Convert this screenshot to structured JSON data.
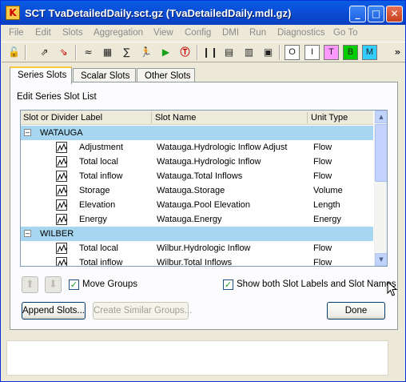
{
  "window": {
    "title": "SCT TvaDetailedDaily.sct.gz (TvaDetailedDaily.mdl.gz)",
    "app_icon_glyph": "K",
    "controls": {
      "minimize": "_",
      "maximize": "□",
      "close": "✕"
    }
  },
  "menu": [
    "File",
    "Edit",
    "Slots",
    "Aggregation",
    "View",
    "Config",
    "DMI",
    "Run",
    "Diagnostics",
    "Go To"
  ],
  "toolbar": {
    "icons": [
      "unlock-icon",
      "open-slot-icon",
      "close-slot-icon",
      "plot-icon",
      "graph-icon",
      "calculator-icon",
      "runner-icon",
      "play-icon",
      "stop-d-icon",
      "bar-icon",
      "expand-icon",
      "collapse-icon",
      "fit-icon"
    ],
    "letter_buttons": [
      {
        "label": "O",
        "color": "#ffffff"
      },
      {
        "label": "I",
        "color": "#ffffff"
      },
      {
        "label": "T",
        "color": "#ff99ff"
      },
      {
        "label": "B",
        "color": "#00cc00"
      },
      {
        "label": "M",
        "color": "#33ccff"
      }
    ],
    "overflow": "»"
  },
  "tabs": [
    "Series Slots",
    "Scalar Slots",
    "Other Slots"
  ],
  "panel": {
    "heading": "Edit Series Slot List",
    "columns": [
      "Slot or Divider Label",
      "Slot Name",
      "Unit Type"
    ],
    "groups": [
      {
        "name": "WATAUGA",
        "rows": [
          {
            "label": "Adjustment",
            "slot": "Watauga.Hydrologic Inflow Adjust",
            "unit": "Flow"
          },
          {
            "label": "Total local",
            "slot": "Watauga.Hydrologic Inflow",
            "unit": "Flow"
          },
          {
            "label": "Total inflow",
            "slot": "Watauga.Total Inflows",
            "unit": "Flow"
          },
          {
            "label": "Storage",
            "slot": "Watauga.Storage",
            "unit": "Volume"
          },
          {
            "label": "Elevation",
            "slot": "Watauga.Pool Elevation",
            "unit": "Length"
          },
          {
            "label": "Energy",
            "slot": "Watauga.Energy",
            "unit": "Energy"
          }
        ]
      },
      {
        "name": "WILBER",
        "rows": [
          {
            "label": "Total local",
            "slot": "Wilbur.Hydrologic Inflow",
            "unit": "Flow"
          },
          {
            "label": "Total inflow",
            "slot": "Wilbur.Total Inflows",
            "unit": "Flow"
          }
        ]
      }
    ],
    "move_groups_label": "Move Groups",
    "move_groups_checked": true,
    "show_both_label": "Show both Slot Labels and Slot Names",
    "show_both_checked": true,
    "append_label": "Append Slots...",
    "create_similar_label": "Create Similar Groups...",
    "done_label": "Done"
  },
  "colors": {
    "group_row": "#a6d6f0",
    "titlebar": "#0a5de5"
  }
}
